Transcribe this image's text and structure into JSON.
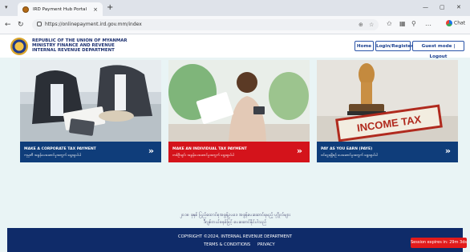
{
  "browser": {
    "tab_title": "IRD Payment Hub Portal",
    "tab_close": "×",
    "new_tab": "+",
    "url": "https://onlinepayment.ird.gov.mm/index",
    "profile_label": "Chat"
  },
  "header": {
    "org_line1": "REPUBLIC OF THE UNION OF MYANMAR",
    "org_line2": "MINISTRY FINANCE AND REVENUE",
    "org_line3": "INTERNAL REVENUE DEPARTMENT",
    "nav": [
      {
        "label": "Home"
      },
      {
        "label": "Login/Register"
      },
      {
        "label": "Guest mode | Logout"
      }
    ]
  },
  "cards": [
    {
      "title": "MAKE A CORPORATE TAX PAYMENT",
      "subtitle": "ကုမ္ပဏီ အခွန်ပေးဆောင်မှုအတွက် ရွေးချယ်ပါ",
      "color": "#0f3d7a",
      "arrow": "»"
    },
    {
      "title": "MAKE AN INDIVIDUAL TAX PAYMENT",
      "subtitle": "တစ်ဦးချင်း အခွန်ပေးဆောင်မှုအတွက် ရွေးချယ်ပါ",
      "color": "#d4131b",
      "arrow": "»"
    },
    {
      "title": "PAY AS YOU EARN (PAYE)",
      "subtitle": "ဝင်ငွေရရှိစဉ် ပေးဆောင်မှုအတွက် ရွေးချယ်ပါ",
      "color": "#0f3d7a",
      "arrow": "»",
      "image_text": "INCOME TAX"
    }
  ],
  "notice": {
    "line1": "၂၀၁၈ ခုနှစ် ပြည်ထောင်စုအခွန်ဥပဒေ အခွန်ပေးဆောင်ရမည့် ပုဂ္ဂိုလ်များ",
    "line2": "ဒီဂျစ်တယ်စနစ်ဖြင့် ပေးဆောင်နိုင်ပါသည်"
  },
  "footer": {
    "copyright": "COPYRIGHT ©2024, INTERNAL REVENUE DEPARTMENT",
    "terms": "TERMS & CONDITIONS",
    "privacy": "PRIVACY"
  },
  "session": {
    "label": "Session expires in: 29m 3ds"
  }
}
